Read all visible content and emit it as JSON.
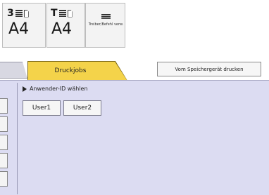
{
  "trays": [
    {
      "number": "3",
      "size": "A4"
    },
    {
      "number": "T",
      "size": "A4"
    }
  ],
  "driver_control": {
    "label": "Treiber/Befehl verw."
  },
  "tabs": {
    "active_label": "Druckjobs",
    "stored_print_label": "Vom Speichergerät drucken"
  },
  "user_select": {
    "heading": "Anwender-ID wählen",
    "users": [
      "User1",
      "User2"
    ]
  },
  "colors": {
    "active_tab": "#f4d34a",
    "panel": "#dcdcf2"
  }
}
